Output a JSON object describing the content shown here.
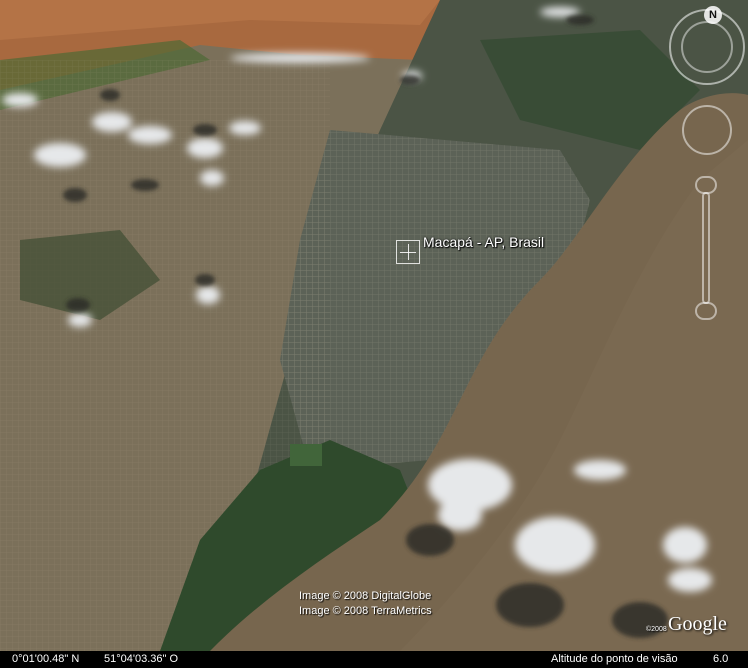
{
  "placemark": {
    "label": "Macapá - AP, Brasil"
  },
  "controls": {
    "north_label": "N"
  },
  "attribution": {
    "line1": "Image © 2008 DigitalGlobe",
    "line2": "Image © 2008 TerraMetrics",
    "logo": "Google",
    "logo_year": "©2008"
  },
  "status_bar": {
    "latitude": "0°01'00.48\" N",
    "longitude": "51°04'03.36\" O",
    "altitude_label": "Altitude do ponto de visão",
    "altitude_value": "6.0"
  },
  "colors": {
    "river": "#7a6a52",
    "land_left": "#7e725c",
    "land_right": "#4e5646",
    "forest": "#2f4a2c",
    "urban": "#b06a3c",
    "clouds": "#e6e8ea"
  }
}
